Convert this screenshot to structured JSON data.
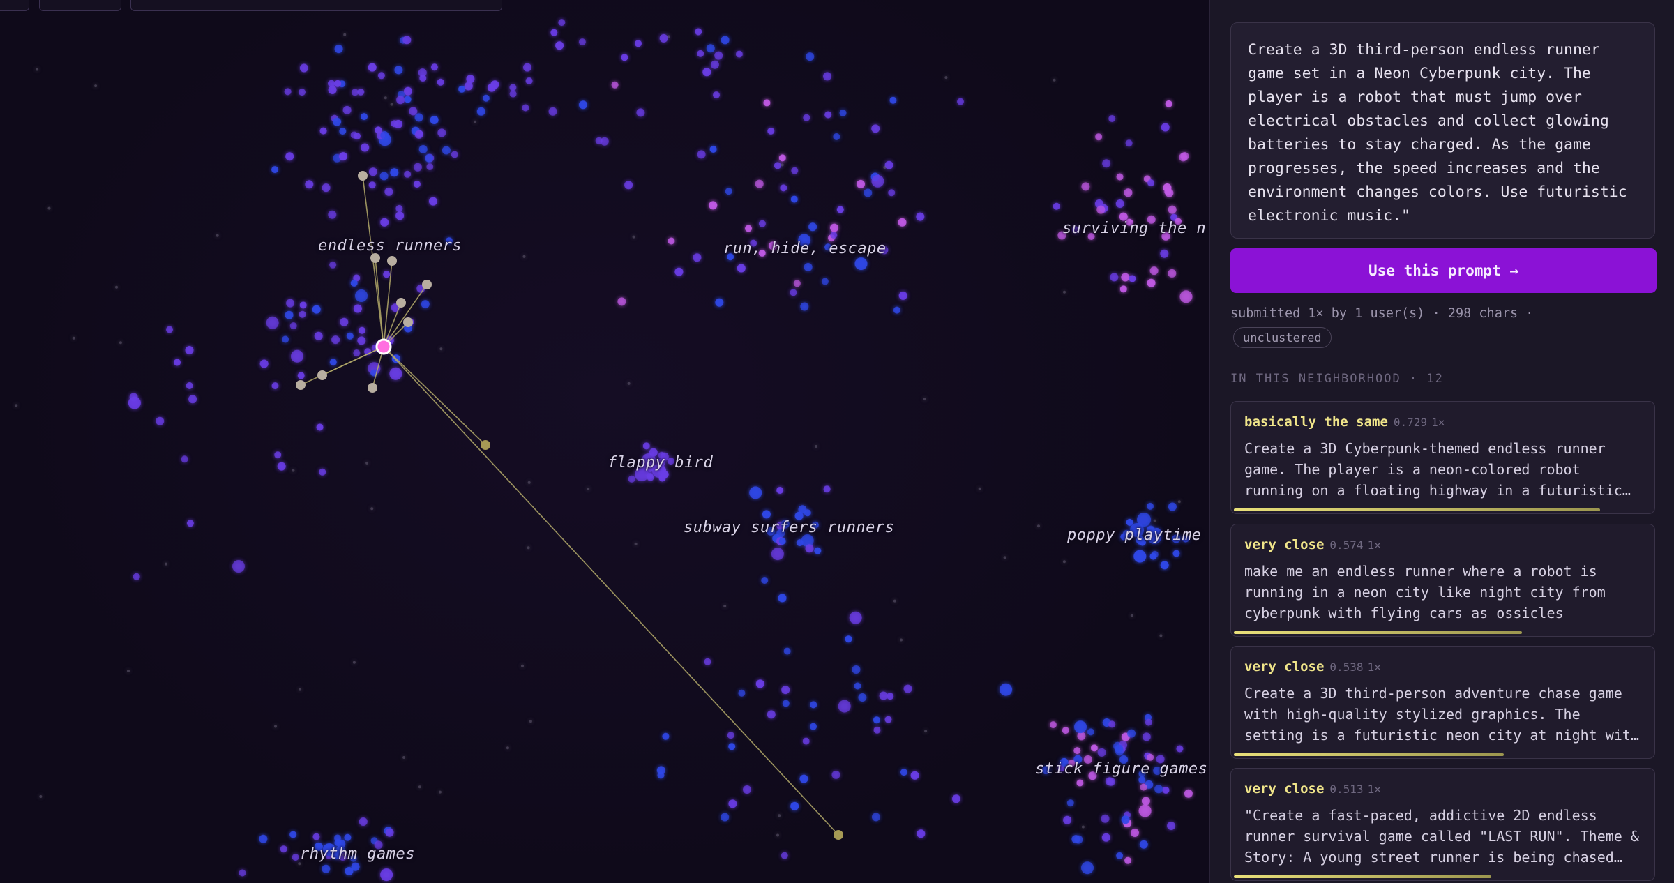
{
  "map": {
    "cluster_labels": [
      {
        "text": "endless runners"
      },
      {
        "text": "run, hide, escape"
      },
      {
        "text": "surviving the n"
      },
      {
        "text": "flappy bird"
      },
      {
        "text": "subway surfers runners"
      },
      {
        "text": "poppy playtime"
      },
      {
        "text": "stick figure games"
      },
      {
        "text": "rhythm games"
      }
    ],
    "colors": {
      "blue": "#2f48e8",
      "violet": "#6a3de6",
      "magenta": "#c25ae6",
      "neighbor_line": "#b4ab6a",
      "selected": "#ff6fe0"
    }
  },
  "panel": {
    "prompt_text": "Create a 3D third-person endless runner game set in a Neon Cyberpunk city. The player is a robot that must jump over electrical obstacles and collect glowing batteries to stay charged. As the game progresses, the speed increases and the environment changes colors. Use futuristic electronic music.\"",
    "use_button_label": "Use this prompt →",
    "meta_text": "submitted 1× by 1 user(s) · 298 chars ·",
    "tag": "unclustered",
    "neighborhood_heading": "IN THIS NEIGHBORHOOD · 12",
    "neighbors": [
      {
        "label": "basically the same",
        "score": "0.729",
        "count": "1×",
        "similarity": 0.729,
        "text": "Create a 3D Cyberpunk-themed endless runner game. The player is a neon-colored robot running on a floating highway in a futuristic city."
      },
      {
        "label": "very close",
        "score": "0.574",
        "count": "1×",
        "similarity": 0.574,
        "text": "make me an endless runner where a robot is running in a neon city like night city from cyberpunk with flying cars as ossicles"
      },
      {
        "label": "very close",
        "score": "0.538",
        "count": "1×",
        "similarity": 0.538,
        "text": "Create a 3D third-person adventure chase game with high-quality stylized graphics. The setting is a futuristic neon city at night with rain."
      },
      {
        "label": "very close",
        "score": "0.513",
        "count": "1×",
        "similarity": 0.513,
        "text": "\"Create a fast-paced, addictive 2D endless runner survival game called \"LAST RUN\". Theme & Story: A young street runner is being chased through the city."
      }
    ]
  }
}
